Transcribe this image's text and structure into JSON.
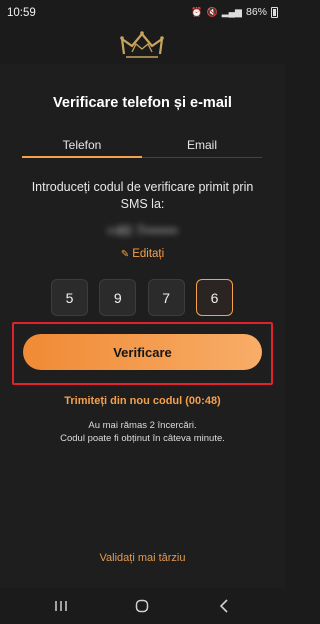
{
  "status_bar": {
    "time": "10:59",
    "battery": "86%",
    "icons": [
      "alarm-icon",
      "mute-icon",
      "data-4g-icon",
      "signal-icon",
      "battery-icon"
    ]
  },
  "header": {
    "logo": "crown-logo"
  },
  "page": {
    "title": "Verificare telefon și e-mail",
    "tabs": [
      {
        "label": "Telefon",
        "active": true
      },
      {
        "label": "Email",
        "active": false
      }
    ],
    "instructions": "Introduceți codul de verificare primit prin SMS la:",
    "edit_label": "Editați",
    "code_digits": [
      "5",
      "9",
      "7",
      "6"
    ],
    "verify_button": "Verificare",
    "resend_label": "Trimiteți din nou codul (00:48)",
    "attempts_line1": "Au mai rămas 2 încercări.",
    "attempts_line2": "Codul poate fi obținut în câteva minute.",
    "later_link": "Validați mai târziu"
  },
  "nav": {
    "icons": [
      "recent-apps-icon",
      "home-icon",
      "back-icon"
    ]
  },
  "colors": {
    "accent": "#f5a04a",
    "background": "#1e1e1e",
    "highlight_frame": "#e1222c"
  }
}
